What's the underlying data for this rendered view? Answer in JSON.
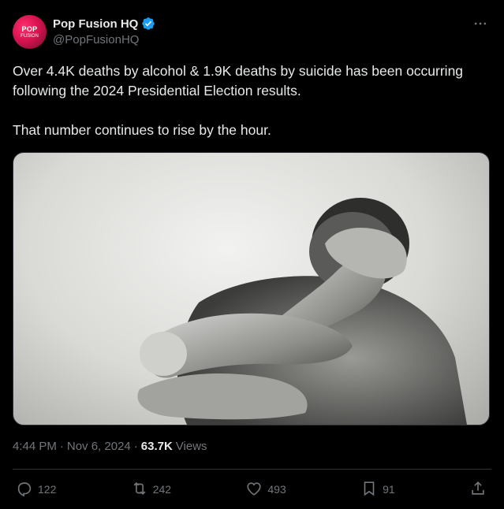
{
  "author": {
    "display_name": "Pop Fusion HQ",
    "handle": "@PopFusionHQ",
    "avatar_text_top": "POP",
    "avatar_text_bottom": "FUSION"
  },
  "tweet": {
    "paragraph1": "Over 4.4K deaths by alcohol & 1.9K deaths by suicide has been occurring following the 2024 Presidential Election results.",
    "paragraph2": "That number continues to rise by the hour."
  },
  "meta": {
    "time": "4:44 PM",
    "separator": "·",
    "date": "Nov 6, 2024",
    "views_count": "63.7K",
    "views_label": "Views"
  },
  "actions": {
    "replies": "122",
    "reposts": "242",
    "likes": "493",
    "bookmarks": "91"
  },
  "icons": {
    "more": "more-horizontal-icon",
    "verified": "verified-badge-icon",
    "reply": "reply-icon",
    "repost": "repost-icon",
    "like": "heart-icon",
    "bookmark": "bookmark-icon",
    "share": "share-icon"
  },
  "colors": {
    "background": "#000000",
    "text": "#e7e9ea",
    "muted": "#71767b",
    "verified": "#1d9bf0",
    "avatar": "#e0165a"
  }
}
